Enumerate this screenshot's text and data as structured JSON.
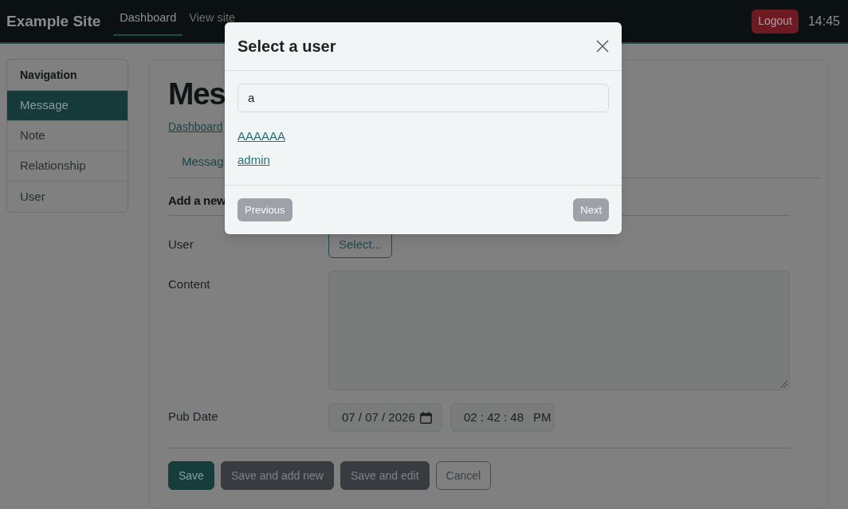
{
  "navbar": {
    "brand": "Example Site",
    "links": [
      {
        "label": "Dashboard",
        "selected": true
      },
      {
        "label": "View site",
        "selected": false
      }
    ],
    "logout_button": "Logout",
    "time": "14:45"
  },
  "sidebar": {
    "title": "Navigation",
    "items": [
      {
        "label": "Message",
        "selected": true
      },
      {
        "label": "Note",
        "selected": false
      },
      {
        "label": "Relationship",
        "selected": false
      },
      {
        "label": "User",
        "selected": false
      }
    ]
  },
  "main": {
    "heading": "Mes",
    "breadcrumb": "Dashboard",
    "tabs": [
      {
        "label": "Messag"
      }
    ],
    "section_title": "Add a new",
    "form": {
      "fields": [
        {
          "label": "User",
          "kind": "select",
          "button": "Select..."
        },
        {
          "label": "Content",
          "kind": "textarea"
        },
        {
          "label": "Pub Date",
          "kind": "datetime",
          "date": "07 / 07 / 2026",
          "time": "02 : 42 : 48",
          "period": "PM"
        }
      ]
    },
    "buttons": [
      {
        "label": "Save",
        "kind": "primary"
      },
      {
        "label": "Save and add new",
        "kind": "dark"
      },
      {
        "label": "Save and edit",
        "kind": "dark"
      },
      {
        "label": "Cancel",
        "kind": "outline"
      }
    ]
  },
  "modal": {
    "title": "Select a user",
    "search": {
      "value": "a"
    },
    "results": [
      "AAAAAA",
      "admin"
    ],
    "buttons": [
      {
        "label": "Previous",
        "disabled": true
      },
      {
        "label": "Next",
        "disabled": true
      }
    ]
  }
}
